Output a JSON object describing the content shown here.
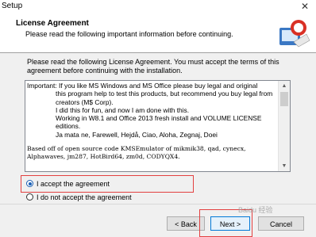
{
  "window": {
    "title": "Setup",
    "close_icon": "close-icon"
  },
  "header": {
    "title": "License Agreement",
    "subtitle": "Please read the following important information before continuing.",
    "logo_icon": "setup-wizard-icon"
  },
  "intro": "Please read the following License Agreement. You must accept the terms of this agreement before continuing with the installation.",
  "license": {
    "lines": [
      "Important: If you like MS Windows and MS Office please buy legal and original",
      "this program help to test this products, but recommend you buy legal from creators (M$ Corp).",
      "I did this for fun, and now I am done with this.",
      "Working in W8.1 and Office 2013 fresh install and VOLUME LICENSE editions.",
      "Ja mata ne, Farewell, Hejdå, Ciao, Aloha, Zegnaj, Doei",
      "Based off of open source code KMSEmulator of mikmik38, qad, cynecx, Alphawaves, jm287, HotBird64, zm0d, CODYQX4."
    ]
  },
  "options": {
    "accept_label": "I accept the agreement",
    "decline_label": "I do not accept the agreement",
    "selected": "accept"
  },
  "buttons": {
    "back": "< Back",
    "next": "Next >",
    "cancel": "Cancel"
  },
  "watermark": "Baidu 经验",
  "colors": {
    "highlight": "#e34040",
    "accent": "#0078d7"
  }
}
